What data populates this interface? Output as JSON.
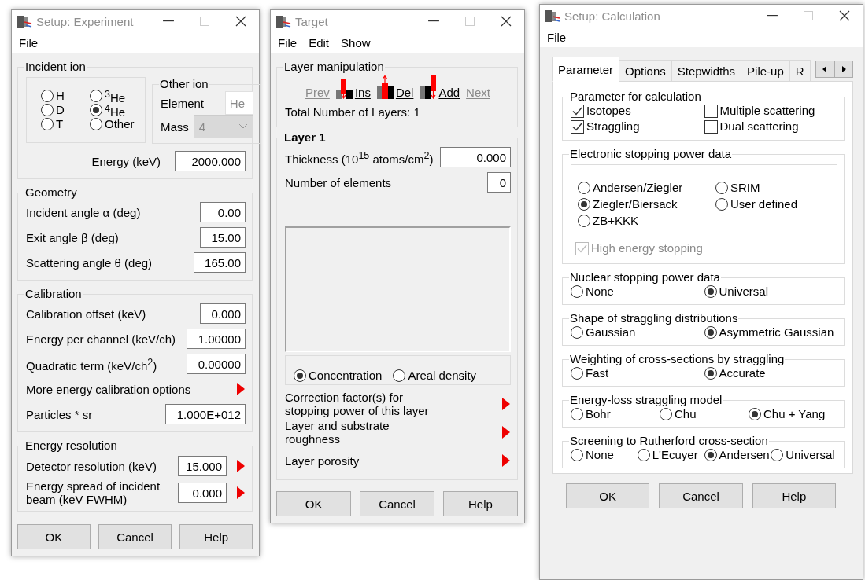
{
  "experiment": {
    "title": "Setup: Experiment",
    "menu": [
      "File"
    ],
    "incident_ion": {
      "label": "Incident ion",
      "ions": [
        {
          "label": "H",
          "selected": false
        },
        {
          "label": "D",
          "selected": false
        },
        {
          "label": "T",
          "selected": false
        },
        {
          "label": "$^{3}$He",
          "selected": false
        },
        {
          "label": "$^{4}$He",
          "selected": true
        },
        {
          "label": "Other",
          "selected": false
        }
      ],
      "other_ion": {
        "label": "Other ion",
        "element": {
          "label": "Element",
          "value": "He",
          "disabled": true
        },
        "mass": {
          "label": "Mass",
          "value": "4",
          "disabled": true
        }
      },
      "energy": {
        "label": "Energy (keV)",
        "value": "2000.000"
      }
    },
    "geometry": {
      "label": "Geometry",
      "rows": [
        {
          "kind": "field",
          "label": "Incident angle α (deg)",
          "value": "0.00"
        },
        {
          "kind": "field",
          "label": "Exit angle β (deg)",
          "value": "15.00"
        },
        {
          "kind": "field",
          "label": "Scattering angle θ (deg)",
          "value": "165.00"
        }
      ]
    },
    "calibration": {
      "label": "Calibration",
      "rows": [
        {
          "kind": "field",
          "label": "Calibration offset (keV)",
          "value": "0.000"
        },
        {
          "kind": "field",
          "label": "Energy per channel (keV/ch)",
          "value": "1.00000"
        },
        {
          "kind": "field",
          "label": "Quadratic term (keV/ch$^{2}$)",
          "value": "0.00000"
        },
        {
          "kind": "link",
          "label": "More energy calibration options"
        },
        {
          "kind": "field",
          "label": "Particles * sr",
          "value": "1.000E+012"
        }
      ]
    },
    "energy_resolution": {
      "label": "Energy resolution",
      "rows": [
        {
          "kind": "field_link",
          "label": "Detector resolution (keV)",
          "value": "15.000"
        },
        {
          "kind": "field_link",
          "label": "Energy spread of incident beam (keV FWHM)",
          "value": "0.000"
        }
      ]
    },
    "buttons": [
      "OK",
      "Cancel",
      "Help"
    ]
  },
  "target": {
    "title": "Target",
    "menu": [
      "File",
      "Edit",
      "Show"
    ],
    "layer_manipulation": {
      "label": "Layer manipulation",
      "buttons": [
        {
          "kind": "plain",
          "label": "Prev",
          "disabled": true
        },
        {
          "kind": "insert",
          "label": "Ins",
          "disabled": false
        },
        {
          "kind": "delete",
          "label": "Del",
          "disabled": false
        },
        {
          "kind": "add",
          "label": "Add",
          "disabled": false
        },
        {
          "kind": "plain",
          "label": "Next",
          "disabled": true
        }
      ],
      "total": "Total Number of Layers: 1"
    },
    "layer": {
      "label": "Layer 1",
      "thickness": {
        "label": "Thickness (10$^{15}$ atoms/cm$^{2}$)",
        "value": "0.000"
      },
      "elements": {
        "label": "Number of elements",
        "value": "0"
      },
      "modes": [
        {
          "label": "Concentration",
          "selected": true
        },
        {
          "label": "Areal density",
          "selected": false
        }
      ],
      "options": [
        "Correction factor(s) for stopping power of this layer",
        "Layer and substrate roughness",
        "Layer porosity"
      ]
    },
    "buttons": [
      "OK",
      "Cancel",
      "Help"
    ]
  },
  "calculation": {
    "title": "Setup: Calculation",
    "menu": [
      "File"
    ],
    "tabs": [
      {
        "label": "Parameter",
        "selected": true
      },
      {
        "label": "Options",
        "selected": false
      },
      {
        "label": "Stepwidths",
        "selected": false
      },
      {
        "label": "Pile-up",
        "selected": false
      },
      {
        "label": "R",
        "selected": false
      }
    ],
    "groups": [
      {
        "kind": "checks",
        "label": "Parameter for calculation",
        "options": [
          {
            "label": "Isotopes",
            "checked": true
          },
          {
            "label": "Multiple scattering",
            "checked": false
          },
          {
            "label": "Straggling",
            "checked": true
          },
          {
            "label": "Dual scattering",
            "checked": false
          }
        ]
      },
      {
        "kind": "electronic",
        "label": "Electronic stopping power data",
        "options": [
          {
            "label": "Andersen/Ziegler",
            "selected": false
          },
          {
            "label": "SRIM",
            "selected": false
          },
          {
            "label": "Ziegler/Biersack",
            "selected": true
          },
          {
            "label": "User defined",
            "selected": false
          },
          {
            "label": "ZB+KKK",
            "selected": false
          }
        ],
        "high_energy": {
          "label": "High energy stopping",
          "checked": true,
          "disabled": true
        }
      },
      {
        "kind": "radios",
        "label": "Nuclear stopping power data",
        "options": [
          {
            "label": "None",
            "selected": false
          },
          {
            "label": "Universal",
            "selected": true
          }
        ]
      },
      {
        "kind": "radios",
        "label": "Shape of straggling distributions",
        "options": [
          {
            "label": "Gaussian",
            "selected": false
          },
          {
            "label": "Asymmetric Gaussian",
            "selected": true
          }
        ]
      },
      {
        "kind": "radios",
        "label": "Weighting of cross-sections by straggling",
        "options": [
          {
            "label": "Fast",
            "selected": false
          },
          {
            "label": "Accurate",
            "selected": true
          }
        ]
      },
      {
        "kind": "radios",
        "label": "Energy-loss straggling model",
        "options": [
          {
            "label": "Bohr",
            "selected": false
          },
          {
            "label": "Chu",
            "selected": false
          },
          {
            "label": "Chu + Yang",
            "selected": true
          }
        ]
      },
      {
        "kind": "radios",
        "label": "Screening to Rutherford cross-section",
        "options": [
          {
            "label": "None",
            "selected": false
          },
          {
            "label": "L'Ecuyer",
            "selected": false
          },
          {
            "label": "Andersen",
            "selected": true
          },
          {
            "label": "Universal",
            "selected": false
          }
        ]
      }
    ],
    "buttons": [
      "OK",
      "Cancel",
      "Help"
    ]
  }
}
